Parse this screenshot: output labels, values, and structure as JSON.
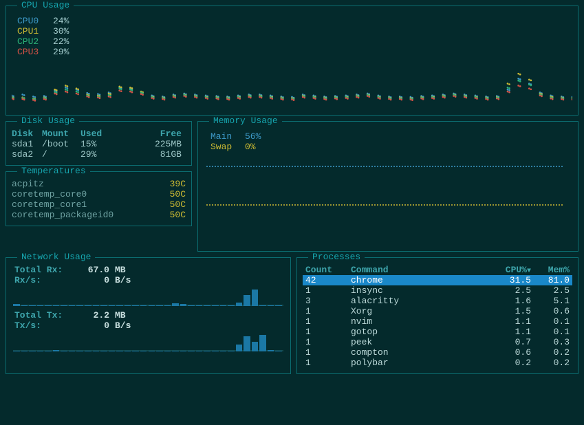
{
  "cpu": {
    "title": "CPU Usage",
    "cores": [
      {
        "name": "CPU0",
        "pct": "24%"
      },
      {
        "name": "CPU1",
        "pct": "30%"
      },
      {
        "name": "CPU2",
        "pct": "22%"
      },
      {
        "name": "CPU3",
        "pct": "29%"
      }
    ],
    "chart_data": {
      "type": "line",
      "x_range": [
        0,
        100
      ],
      "y_range": [
        0,
        100
      ],
      "series": [
        {
          "name": "CPU0",
          "color": "#3e9bca",
          "values": [
            28,
            30,
            26,
            27,
            38,
            44,
            40,
            33,
            31,
            34,
            44,
            42,
            35,
            28,
            26,
            30,
            32,
            30,
            28,
            27,
            26,
            28,
            30,
            30,
            28,
            26,
            25,
            30,
            28,
            26,
            27,
            28,
            30,
            32,
            28,
            26,
            26,
            25,
            27,
            28,
            30,
            32,
            30,
            28,
            26,
            27,
            40,
            62,
            52,
            34,
            28,
            26,
            25
          ]
        },
        {
          "name": "CPU1",
          "color": "#cdbb33",
          "values": [
            25,
            24,
            22,
            24,
            40,
            48,
            42,
            30,
            28,
            32,
            46,
            44,
            36,
            26,
            24,
            28,
            30,
            28,
            26,
            25,
            24,
            26,
            28,
            28,
            26,
            24,
            23,
            28,
            26,
            24,
            25,
            26,
            28,
            30,
            26,
            24,
            24,
            23,
            25,
            26,
            28,
            30,
            28,
            26,
            24,
            25,
            52,
            72,
            60,
            32,
            26,
            24,
            23
          ]
        },
        {
          "name": "CPU2",
          "color": "#2cb378",
          "values": [
            24,
            23,
            21,
            23,
            35,
            40,
            36,
            28,
            26,
            29,
            42,
            40,
            34,
            25,
            23,
            27,
            29,
            27,
            25,
            24,
            23,
            25,
            27,
            27,
            25,
            23,
            22,
            27,
            25,
            23,
            24,
            25,
            27,
            29,
            25,
            23,
            23,
            22,
            24,
            25,
            27,
            29,
            27,
            25,
            23,
            24,
            44,
            58,
            50,
            30,
            24,
            23,
            22
          ]
        },
        {
          "name": "CPU3",
          "color": "#d85246",
          "values": [
            22,
            21,
            19,
            21,
            32,
            36,
            32,
            26,
            24,
            26,
            38,
            36,
            31,
            23,
            21,
            25,
            27,
            25,
            23,
            22,
            21,
            23,
            25,
            25,
            23,
            21,
            20,
            25,
            23,
            21,
            22,
            23,
            25,
            27,
            23,
            21,
            21,
            20,
            22,
            23,
            25,
            27,
            25,
            23,
            21,
            22,
            36,
            48,
            42,
            28,
            22,
            21,
            20
          ]
        }
      ]
    }
  },
  "disk": {
    "title": "Disk Usage",
    "headers": {
      "disk": "Disk",
      "mount": "Mount",
      "used": "Used",
      "free": "Free"
    },
    "rows": [
      {
        "disk": "sda1",
        "mount": "/boot",
        "used": "15%",
        "free": "225MB"
      },
      {
        "disk": "sda2",
        "mount": "/",
        "used": "29%",
        "free": "81GB"
      }
    ]
  },
  "temps": {
    "title": "Temperatures",
    "rows": [
      {
        "name": "acpitz",
        "val": "39C"
      },
      {
        "name": "coretemp_core0",
        "val": "50C"
      },
      {
        "name": "coretemp_core1",
        "val": "50C"
      },
      {
        "name": "coretemp_packageid0",
        "val": "50C"
      }
    ]
  },
  "mem": {
    "title": "Memory Usage",
    "rows": [
      {
        "name": "Main",
        "pct": "56%"
      },
      {
        "name": "Swap",
        "pct": "0%"
      }
    ]
  },
  "net": {
    "title": "Network Usage",
    "rx": {
      "total_label": "Total Rx:",
      "total_val": "67.0",
      "total_unit": "MB",
      "rate_label": "Rx/s:",
      "rate_val": "0",
      "rate_unit": "B/s",
      "chart_data": {
        "type": "bar",
        "values": [
          2,
          1,
          0,
          0,
          0,
          1,
          0,
          0,
          0,
          0,
          0,
          0,
          0,
          0,
          0,
          0,
          0,
          0,
          0,
          0,
          3,
          2,
          0,
          0,
          0,
          0,
          0,
          0,
          4,
          12,
          18,
          1,
          0,
          0
        ]
      }
    },
    "tx": {
      "total_label": "Total Tx:",
      "total_val": "2.2",
      "total_unit": "MB",
      "rate_label": "Tx/s:",
      "rate_val": "0",
      "rate_unit": "B/s",
      "chart_data": {
        "type": "bar",
        "values": [
          0,
          0,
          0,
          0,
          0,
          1,
          0,
          0,
          0,
          0,
          0,
          0,
          0,
          0,
          0,
          0,
          0,
          0,
          0,
          0,
          0,
          0,
          0,
          0,
          0,
          0,
          0,
          0,
          4,
          9,
          6,
          10,
          1,
          0
        ]
      }
    }
  },
  "proc": {
    "title": "Processes",
    "headers": {
      "count": "Count",
      "command": "Command",
      "cpu": "CPU%",
      "mem": "Mem%"
    },
    "sort_arrow": "▼",
    "rows": [
      {
        "count": "42",
        "command": "chrome",
        "cpu": "31.5",
        "mem": "81.0",
        "selected": true
      },
      {
        "count": "1",
        "command": "insync",
        "cpu": "2.5",
        "mem": "2.5",
        "selected": false
      },
      {
        "count": "3",
        "command": "alacritty",
        "cpu": "1.6",
        "mem": "5.1",
        "selected": false
      },
      {
        "count": "1",
        "command": "Xorg",
        "cpu": "1.5",
        "mem": "0.6",
        "selected": false
      },
      {
        "count": "1",
        "command": "nvim",
        "cpu": "1.1",
        "mem": "0.1",
        "selected": false
      },
      {
        "count": "1",
        "command": "gotop",
        "cpu": "1.1",
        "mem": "0.1",
        "selected": false
      },
      {
        "count": "1",
        "command": "peek",
        "cpu": "0.7",
        "mem": "0.3",
        "selected": false
      },
      {
        "count": "1",
        "command": "compton",
        "cpu": "0.6",
        "mem": "0.2",
        "selected": false
      },
      {
        "count": "1",
        "command": "polybar",
        "cpu": "0.2",
        "mem": "0.2",
        "selected": false
      }
    ]
  }
}
